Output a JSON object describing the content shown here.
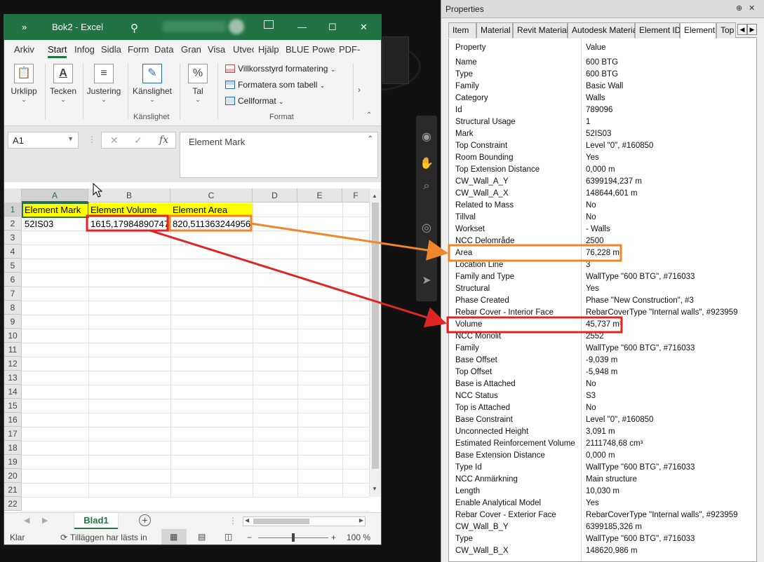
{
  "colors": {
    "excel_green": "#217346",
    "header_yellow": "#ffff00",
    "highlight_orange": "#f0862a",
    "highlight_red": "#e02424"
  },
  "excel": {
    "title_left_icon": "»",
    "title": "Bok2 - Excel",
    "window_controls": [
      "—",
      "☐",
      "✕"
    ],
    "tabs": [
      "Arkiv",
      "Start",
      "Infog",
      "Sidla",
      "Form",
      "Data",
      "Gran",
      "Visa",
      "Utvec",
      "Hjälp",
      "BLUE",
      "Powe",
      "PDF-"
    ],
    "ribbon": {
      "paste_label": "Urklipp",
      "font_label": "Tecken",
      "align_label": "Justering",
      "sensitivity_label": "Känslighet",
      "sensitivity_group": "Känslighet",
      "number_label": "Tal",
      "cond_format": "Villkorsstyrd formatering",
      "format_table": "Formatera som tabell",
      "cell_styles": "Cellformat",
      "format_group": "Format"
    },
    "name_box": "A1",
    "formula_value": "Element Mark",
    "columns": [
      "A",
      "B",
      "C",
      "D",
      "E",
      "F"
    ],
    "rows": [
      "1",
      "2",
      "3",
      "4",
      "5",
      "6",
      "7",
      "8",
      "9",
      "10",
      "11",
      "12",
      "13",
      "14",
      "15",
      "16",
      "17",
      "18",
      "19",
      "20",
      "21",
      "22"
    ],
    "cells": {
      "A1": "Element Mark",
      "B1": "Element Volume",
      "C1": "Element Area",
      "A2": "52IS03",
      "B2": "1615,17984890747",
      "C2": "820,511363244956"
    },
    "sheet_tab": "Blad1",
    "status": {
      "ready": "Klar",
      "addins": "Tilläggen har lästs in",
      "zoom": "100 %"
    }
  },
  "properties": {
    "title": "Properties",
    "tabs": [
      "Item",
      "Material",
      "Revit Material",
      "Autodesk Material",
      "Element ID",
      "Element",
      "Top"
    ],
    "active_tab": "Element",
    "header": {
      "key": "Property",
      "value": "Value"
    },
    "rows": [
      {
        "k": "Name",
        "v": "600 BTG"
      },
      {
        "k": "Type",
        "v": "600 BTG"
      },
      {
        "k": "Family",
        "v": "Basic Wall"
      },
      {
        "k": "Category",
        "v": "Walls"
      },
      {
        "k": "Id",
        "v": "789096"
      },
      {
        "k": "Structural Usage",
        "v": "1"
      },
      {
        "k": "Mark",
        "v": "52IS03"
      },
      {
        "k": "Top Constraint",
        "v": "Level \"0\", #160850"
      },
      {
        "k": "Room Bounding",
        "v": "Yes"
      },
      {
        "k": "Top Extension Distance",
        "v": "0,000 m"
      },
      {
        "k": "CW_Wall_A_Y",
        "v": "6399194,237 m"
      },
      {
        "k": "CW_Wall_A_X",
        "v": "148644,601 m"
      },
      {
        "k": "Related to Mass",
        "v": "No"
      },
      {
        "k": "Tillval",
        "v": "No"
      },
      {
        "k": "Workset",
        "v": "- Walls"
      },
      {
        "k": "NCC Delområde",
        "v": "2500"
      },
      {
        "k": "Area",
        "v": "76,228 m²"
      },
      {
        "k": "Location Line",
        "v": "3"
      },
      {
        "k": "Family and Type",
        "v": "WallType \"600 BTG\", #716033"
      },
      {
        "k": "Structural",
        "v": "Yes"
      },
      {
        "k": "Phase Created",
        "v": "Phase \"New Construction\", #3"
      },
      {
        "k": "Rebar Cover - Interior Face",
        "v": "RebarCoverType \"Internal walls\", #923959"
      },
      {
        "k": "Volume",
        "v": "45,737 m³"
      },
      {
        "k": "NCC Monolit",
        "v": "2552"
      },
      {
        "k": "Family",
        "v": "WallType \"600 BTG\", #716033"
      },
      {
        "k": "Base Offset",
        "v": "-9,039 m"
      },
      {
        "k": "Top Offset",
        "v": "-5,948 m"
      },
      {
        "k": "Base is Attached",
        "v": "No"
      },
      {
        "k": "NCC Status",
        "v": "S3"
      },
      {
        "k": "Top is Attached",
        "v": "No"
      },
      {
        "k": "Base Constraint",
        "v": "Level \"0\", #160850"
      },
      {
        "k": "Unconnected Height",
        "v": "3,091 m"
      },
      {
        "k": "Estimated Reinforcement Volume",
        "v": "2111748,68 cm³"
      },
      {
        "k": "Base Extension Distance",
        "v": "0,000 m"
      },
      {
        "k": "Type Id",
        "v": "WallType \"600 BTG\", #716033"
      },
      {
        "k": "NCC Anmärkning",
        "v": "Main structure"
      },
      {
        "k": "Length",
        "v": "10,030 m"
      },
      {
        "k": "Enable Analytical Model",
        "v": "Yes"
      },
      {
        "k": "Rebar Cover - Exterior Face",
        "v": "RebarCoverType \"Internal walls\", #923959"
      },
      {
        "k": "CW_Wall_B_Y",
        "v": "6399185,326 m"
      },
      {
        "k": "Type",
        "v": "WallType \"600 BTG\", #716033"
      },
      {
        "k": "CW_Wall_B_X",
        "v": "148620,986 m"
      }
    ]
  }
}
